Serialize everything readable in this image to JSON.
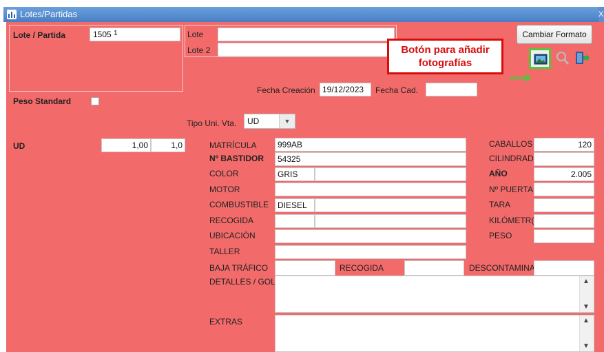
{
  "window": {
    "title": "Lotes/Partidas",
    "close_glyph": "X"
  },
  "header": {
    "lote_partida_label": "Lote / Partida",
    "lote_partida_value": "1505",
    "lote_partida_suffix": "1",
    "lote_label": "Lote",
    "lote2_label": "Lote 2",
    "lote_value": "",
    "lote2_value": "",
    "peso_standard_label": "Peso Standard",
    "fecha_creacion_label": "Fecha Creación",
    "fecha_creacion_value": "19/12/2023",
    "fecha_cad_label": "Fecha Cad.",
    "fecha_cad_value": "",
    "tipo_uni_vta_label": "Tipo Uni. Vta.",
    "tipo_uni_vta_value": "UD",
    "ud_label": "UD",
    "ud_value1": "1,00",
    "ud_value2": "1,0"
  },
  "toolbar": {
    "cambiar_formato_label": "Cambiar Formato",
    "photo_icon": "image-icon",
    "search_icon": "search-icon",
    "exit_icon": "exit-icon"
  },
  "callout": {
    "line1": "Botón para añadir",
    "line2": "fotografías",
    "color": "#d80c0c"
  },
  "vehicle": {
    "matricula_label": "MATRÍCULA",
    "matricula_value": "999AB",
    "bastidor_label": "Nº BASTIDOR",
    "bastidor_value": "54325",
    "color_label": "COLOR",
    "color_value": "GRIS",
    "motor_label": "MOTOR",
    "combustible_label": "COMBUSTIBLE",
    "combustible_value": "DIESEL",
    "recogida_label": "RECOGIDA",
    "ubicacion_label": "UBICACIÓN",
    "taller_label": "TALLER",
    "baja_trafico_label": "BAJA TRÁFICO",
    "recogida2_label": "RECOGIDA",
    "descontamina_label": "DESCONTAMINA",
    "detalles_label": "DETALLES / GOL",
    "extras_label": "EXTRAS",
    "caballos_label": "CABALLOS",
    "caballos_value": "120",
    "cilindrada_label": "CILINDRAD",
    "anio_label": "AÑO",
    "anio_value": "2.005",
    "puertas_label": "Nº PUERTA",
    "tara_label": "TARA",
    "kilometros_label": "KILÓMETR(",
    "peso_label": "PESO"
  },
  "colors": {
    "panel": "#f26a6a",
    "titlebar": "#4a7ec4",
    "highlight": "#57c43f"
  }
}
